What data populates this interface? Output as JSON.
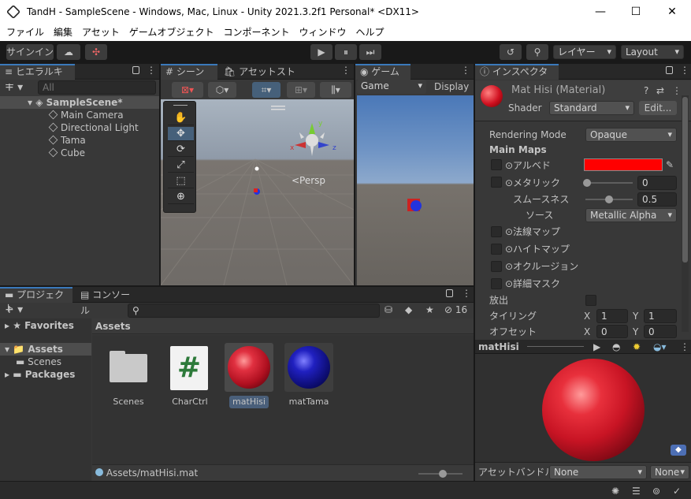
{
  "window": {
    "title": "TandH - SampleScene - Windows, Mac, Linux - Unity 2021.3.2f1 Personal* <DX11>",
    "min": "—",
    "max": "☐",
    "close": "✕"
  },
  "menu": [
    "ファイル",
    "編集",
    "アセット",
    "ゲームオブジェクト",
    "コンポーネント",
    "ウィンドウ",
    "ヘルプ"
  ],
  "toolbar": {
    "signin": "サインイン",
    "cloud": "☁",
    "collab": "✣",
    "play": "▶",
    "pause": "⏸",
    "step": "⏭",
    "history": "↺",
    "search": "⚲",
    "layers": "レイヤー",
    "layout": "Layout"
  },
  "hierarchy": {
    "tab": "ヒエラルキー",
    "add": "+ ▾",
    "search_placeholder": "All",
    "scene": "SampleScene*",
    "items": [
      "Main Camera",
      "Directional Light",
      "Tama",
      "Cube"
    ]
  },
  "scene": {
    "tab_scene": "シーン",
    "tab_store": "アセットストア",
    "persp": "<Persp",
    "axis_x": "x",
    "axis_y": "y",
    "axis_z": "z"
  },
  "game": {
    "tab": "ゲーム",
    "display_mode": "Game",
    "display": "Display"
  },
  "project": {
    "tab_project": "プロジェクト",
    "tab_console": "コンソール",
    "add": "+ ▾",
    "count": "16",
    "favorites": "Favorites",
    "assets": "Assets",
    "scenes_folder": "Scenes",
    "packages": "Packages",
    "assets_header": "Assets",
    "path": "Assets/matHisi.mat",
    "files": [
      {
        "name": "Scenes",
        "kind": "folder"
      },
      {
        "name": "CharCtrl",
        "kind": "script",
        "glyph": "#"
      },
      {
        "name": "matHisi",
        "kind": "red-material"
      },
      {
        "name": "matTama",
        "kind": "blue-material"
      }
    ]
  },
  "inspector": {
    "tab": "インスペクター",
    "material_name": "Mat Hisi (Material)",
    "shader_label": "Shader",
    "shader_value": "Standard",
    "edit": "Edit...",
    "rendering_mode_label": "Rendering Mode",
    "rendering_mode": "Opaque",
    "main_maps": "Main Maps",
    "albedo": "⊙アルベド",
    "metallic": "⊙メタリック",
    "metallic_value": "0",
    "smoothness": "スムースネス",
    "smoothness_value": "0.5",
    "source": "ソース",
    "source_value": "Metallic Alpha",
    "normal": "⊙法線マップ",
    "height": "⊙ハイトマップ",
    "occlusion": "⊙オクルージョン",
    "detail": "⊙詳細マスク",
    "emission": "放出",
    "tiling": "タイリング",
    "offset": "オフセット",
    "tx_label": "X",
    "tx": "1",
    "ty_label": "Y",
    "ty": "1",
    "ox_label": "X",
    "ox": "0",
    "oy_label": "Y",
    "oy": "0",
    "preview_title": "matHisi",
    "bundle_label": "アセットバンドル",
    "bundle_value": "None",
    "bundle_variant": "None",
    "albedo_color": "#ff0000"
  }
}
